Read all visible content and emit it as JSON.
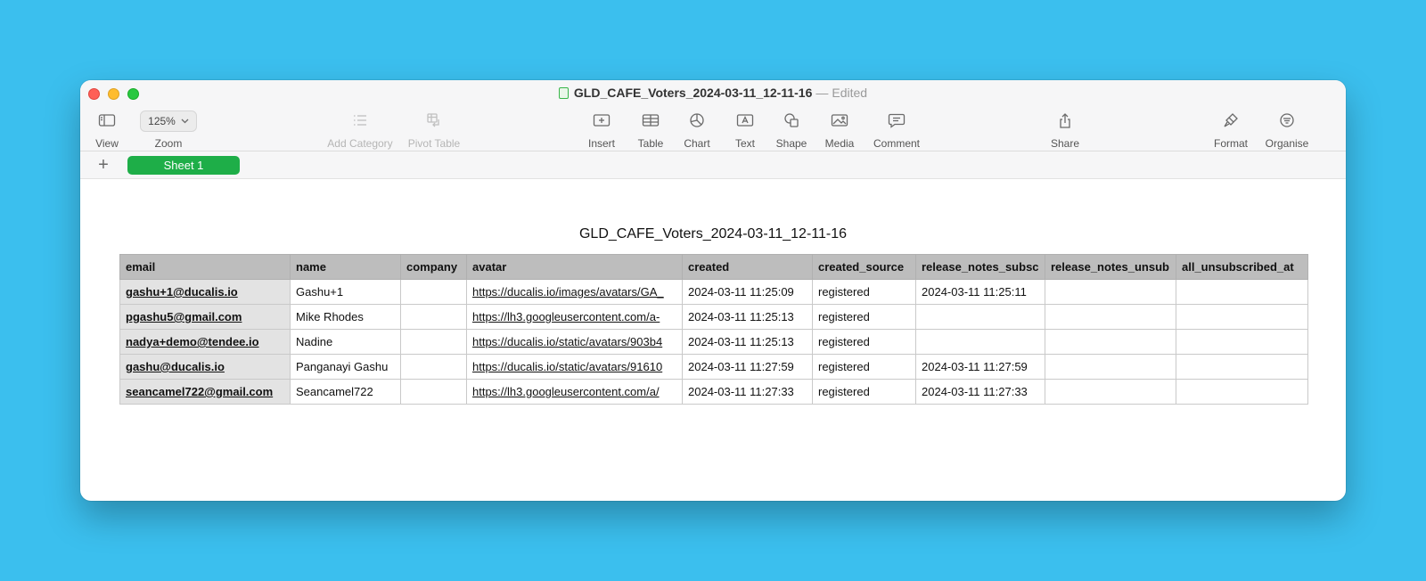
{
  "window": {
    "title": "GLD_CAFE_Voters_2024-03-11_12-11-16",
    "status": "Edited"
  },
  "toolbar": {
    "view": "View",
    "zoom_label": "Zoom",
    "zoom_value": "125%",
    "add_category": "Add Category",
    "pivot_table": "Pivot Table",
    "insert": "Insert",
    "table": "Table",
    "chart": "Chart",
    "text": "Text",
    "shape": "Shape",
    "media": "Media",
    "comment": "Comment",
    "share": "Share",
    "format": "Format",
    "organise": "Organise"
  },
  "sheets": {
    "add_label": "+",
    "active": "Sheet 1"
  },
  "sheet": {
    "title": "GLD_CAFE_Voters_2024-03-11_12-11-16",
    "columns": [
      "email",
      "name",
      "company",
      "avatar",
      "created",
      "created_source",
      "release_notes_subsc",
      "release_notes_unsub",
      "all_unsubscribed_at"
    ],
    "rows": [
      [
        "gashu+1@ducalis.io",
        "Gashu+1",
        "",
        "https://ducalis.io/images/avatars/GA_",
        "2024-03-11 11:25:09",
        "registered",
        "2024-03-11 11:25:11",
        "",
        ""
      ],
      [
        "pgashu5@gmail.com",
        "Mike Rhodes",
        "",
        "https://lh3.googleusercontent.com/a-",
        "2024-03-11 11:25:13",
        "registered",
        "",
        "",
        ""
      ],
      [
        "nadya+demo@tendee.io",
        "Nadine",
        "",
        "https://ducalis.io/static/avatars/903b4",
        "2024-03-11 11:25:13",
        "registered",
        "",
        "",
        ""
      ],
      [
        "gashu@ducalis.io",
        "Panganayi Gashu",
        "",
        "https://ducalis.io/static/avatars/91610",
        "2024-03-11 11:27:59",
        "registered",
        "2024-03-11 11:27:59",
        "",
        ""
      ],
      [
        "seancamel722@gmail.com",
        "Seancamel722",
        "",
        "https://lh3.googleusercontent.com/a/",
        "2024-03-11 11:27:33",
        "registered",
        "2024-03-11 11:27:33",
        "",
        ""
      ]
    ]
  }
}
